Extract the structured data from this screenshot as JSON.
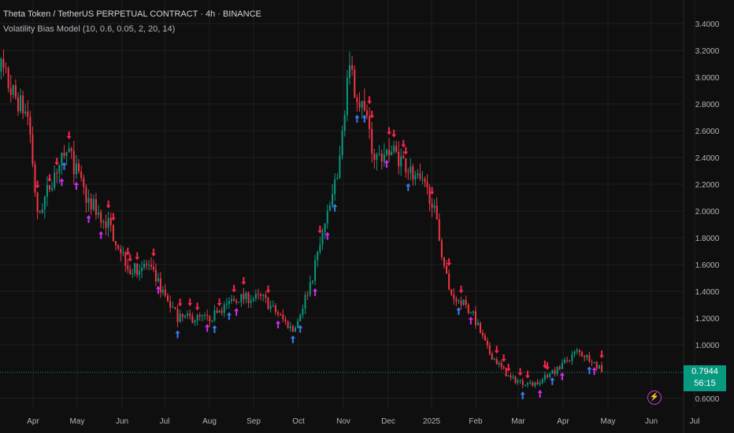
{
  "header": {
    "title": "Theta Token / TetherUS PERPETUAL CONTRACT · 4h · BINANCE",
    "indicator": "Volatility Bias Model (10, 0.6, 0.05, 2, 20, 14)"
  },
  "price_label": {
    "price": "0.7944",
    "countdown": "56:15"
  },
  "colors": {
    "up": "#089981",
    "down": "#f23645",
    "bear_signal": "#f7254b",
    "bull_signal": "#3a7bf0",
    "alt_signal": "#d42bf0",
    "grid": "#1f1f1f"
  },
  "chart_data": {
    "type": "candlestick",
    "title": "Theta Token / TetherUS PERPETUAL CONTRACT · 4h · BINANCE",
    "yticks": [
      "3.4000",
      "3.2000",
      "3.0000",
      "2.8000",
      "2.6000",
      "2.4000",
      "2.2000",
      "2.0000",
      "1.8000",
      "1.6000",
      "1.4000",
      "1.2000",
      "1.0000",
      "0.6000"
    ],
    "ytick_values": [
      3.4,
      3.2,
      3.0,
      2.8,
      2.6,
      2.4,
      2.2,
      2.0,
      1.8,
      1.6,
      1.4,
      1.2,
      1.0,
      0.6
    ],
    "xticks": [
      "Apr",
      "May",
      "Jun",
      "Jul",
      "Aug",
      "Sep",
      "Oct",
      "Nov",
      "Dec",
      "2025",
      "Feb",
      "Mar",
      "Apr",
      "May",
      "Jun",
      "Jul"
    ],
    "ylim": [
      0.55,
      3.5
    ],
    "path_t": [
      0,
      0.5,
      0.9,
      1.1,
      1.5,
      1.8,
      2.2,
      2.7,
      3.2,
      3.6,
      4.3,
      5.0,
      5.6,
      6.2,
      6.9,
      7.3,
      7.9,
      8.1,
      8.4,
      8.7,
      9.1,
      9.4,
      10.0,
      10.4,
      10.9,
      11.3,
      11.8,
      12.3,
      12.8,
      13.3,
      13.6,
      13.9
    ],
    "path_price": [
      3.3,
      2.9,
      2.7,
      1.95,
      2.3,
      2.45,
      2.1,
      1.9,
      1.55,
      1.6,
      1.2,
      1.2,
      1.35,
      1.35,
      1.1,
      1.5,
      2.3,
      3.05,
      2.8,
      2.4,
      2.45,
      2.35,
      2.1,
      1.4,
      1.25,
      0.95,
      0.75,
      0.7,
      0.8,
      0.95,
      0.9,
      0.79
    ],
    "last_price": 0.7944
  }
}
